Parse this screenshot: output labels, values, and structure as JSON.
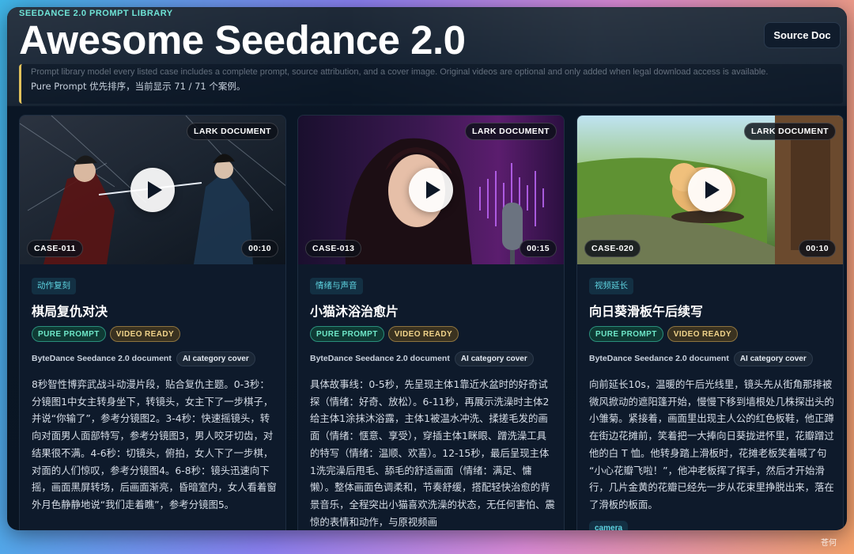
{
  "header": {
    "kicker": "SEEDANCE 2.0 PROMPT LIBRARY",
    "title": "Awesome Seedance 2.0",
    "source_button": "Source Doc"
  },
  "notice": {
    "line1": "Prompt library model every listed case includes a complete prompt, source attribution, and a cover image. Original videos are optional and only added when legal download access is available.",
    "line2": "Pure Prompt 优先排序，当前显示 71 / 71 个案例。"
  },
  "cards": [
    {
      "doc_badge": "LARK DOCUMENT",
      "case_id": "CASE-011",
      "duration": "00:10",
      "category": "动作复刻",
      "title": "棋局复仇对决",
      "pill_pure": "PURE PROMPT",
      "pill_video": "VIDEO READY",
      "source": "ByteDance Seedance 2.0 document",
      "cover": "AI category cover",
      "description": "8秒智性博弈武战斗动漫片段，贴合复仇主题。0-3秒：分镜图1中女主转身坐下，转镜头，女主下了一步棋子，并说“你输了”，参考分镜图2。3-4秒：快速摇镜头，转向对面男人面部特写，参考分镜图3，男人咬牙切齿，对结果很不满。4-6秒：切镜头，俯拍，女人下了一步棋，对面的人们惊叹，参考分镜图4。6-8秒：镜头迅速向下摇，画面黑屏转场，后画面渐亮，昏暗室内，女人看着窗外月色静静地说“我们走着瞧”，参考分镜图5。"
    },
    {
      "doc_badge": "LARK DOCUMENT",
      "case_id": "CASE-013",
      "duration": "00:15",
      "category": "情绪与声音",
      "title": "小猫沐浴治愈片",
      "pill_pure": "PURE PROMPT",
      "pill_video": "VIDEO READY",
      "source": "ByteDance Seedance 2.0 document",
      "cover": "AI category cover",
      "description": "具体故事线：0-5秒，先呈现主体1靠近水盆时的好奇试探（情绪：好奇、放松）。6-11秒，再展示洗澡时主体2给主体1涂抹沐浴露，主体1被温水冲洗、揉搓毛发的画面（情绪：惬意、享受），穿插主体1眯眼、蹭洗澡工具的特写（情绪：温顺、欢喜）。12-15秒，最后呈现主体1洗完澡后甩毛、舔毛的舒适画面（情绪：满足、慵懒）。整体画面色调柔和，节奏舒缓，搭配轻快治愈的背景音乐，全程突出小猫喜欢洗澡的状态，无任何害怕、震惊的表情和动作，与原视频画"
    },
    {
      "doc_badge": "LARK DOCUMENT",
      "case_id": "CASE-020",
      "duration": "00:10",
      "category": "视频延长",
      "title": "向日葵滑板午后续写",
      "pill_pure": "PURE PROMPT",
      "pill_video": "VIDEO READY",
      "source": "ByteDance Seedance 2.0 document",
      "cover": "AI category cover",
      "description": "向前延长10s，温暖的午后光线里，镜头先从街角那排被微风掀动的遮阳篷开始，慢慢下移到墙根处几株探出头的小雏菊。紧接着，画面里出现主人公的红色板鞋，他正蹲在街边花摊前，笑着把一大捧向日葵拢进怀里，花瓣蹭过他的白 T 恤。他转身踏上滑板时，花摊老板笑着喊了句 “小心花瓣飞啦！”，他冲老板挥了挥手，然后才开始滑行，几片金黄的花瓣已经先一步从花束里挣脱出来，落在了滑板的板面。",
      "extra_tag": "camera"
    }
  ],
  "watermark": "苍何",
  "colors": {
    "accent_teal": "#6fe3d6",
    "notice_border": "#e2c25c",
    "card_bg": "#0e1a2b"
  }
}
